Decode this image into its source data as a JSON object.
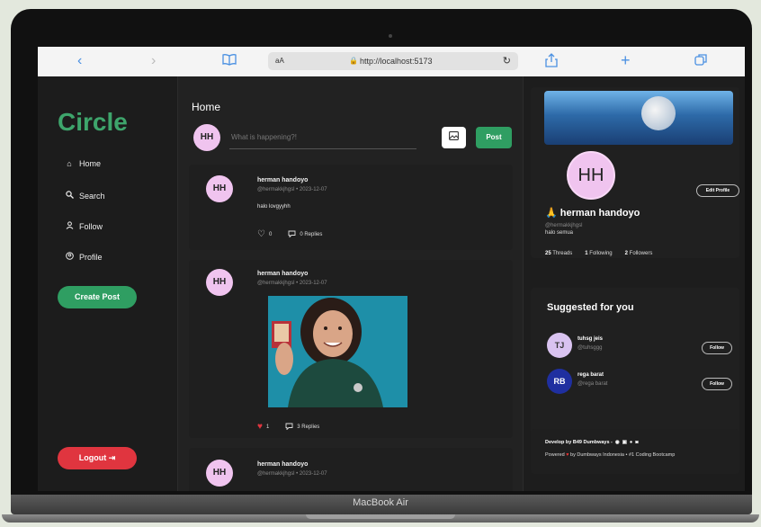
{
  "device": {
    "label": "MacBook Air"
  },
  "browser": {
    "text_size_label": "aA",
    "url": "http://localhost:5173"
  },
  "sidebar": {
    "logo": "Circle",
    "items": [
      {
        "label": "Home",
        "icon": "house-icon"
      },
      {
        "label": "Search",
        "icon": "search-icon"
      },
      {
        "label": "Follow",
        "icon": "person-icon"
      },
      {
        "label": "Profile",
        "icon": "profile-circle-icon"
      }
    ],
    "create_post": "Create Post",
    "logout": "Logout"
  },
  "feed": {
    "title": "Home",
    "composer": {
      "avatar": "HH",
      "placeholder": "What is happening?!",
      "post_button": "Post"
    },
    "posts": [
      {
        "avatar": "HH",
        "name": "herman handoyo",
        "handle": "@hermakkjhgsl",
        "date": "2023-12-07",
        "text": "halo lovgyyhh",
        "likes": "0",
        "replies": "0 Replies",
        "liked": false
      },
      {
        "avatar": "HH",
        "name": "herman handoyo",
        "handle": "@hermakkjhgsl",
        "date": "2023-12-07",
        "text": "",
        "likes": "1",
        "replies": "3 Replies",
        "liked": true
      },
      {
        "avatar": "HH",
        "name": "herman handoyo",
        "handle": "@hermakkjhgsl",
        "date": "2023-12-07",
        "text": ""
      }
    ]
  },
  "profile": {
    "avatar": "HH",
    "edit_button": "Edit Profile",
    "emoji": "🙏",
    "name": "herman handoyo",
    "handle": "@hermakkjhgsl",
    "bio": "halo semua",
    "threads": "25",
    "threads_label": "Threads",
    "following": "1",
    "following_label": "Following",
    "followers": "2",
    "followers_label": "Followers"
  },
  "suggested": {
    "title": "Suggested for you",
    "users": [
      {
        "avatar": "TJ",
        "name": "tuhsg jeis",
        "handle": "@tuhsggg",
        "button": "Follow",
        "color": "#d9c3f0",
        "text_color": "#333333"
      },
      {
        "avatar": "RB",
        "name": "rega barat",
        "handle": "@rega barat",
        "button": "Follow",
        "color": "#1f2fa0",
        "text_color": "#ffffff"
      }
    ]
  },
  "footer": {
    "line1": "Develop by B49 Dumbways -",
    "line2_pre": "Powered",
    "line2_post": "by Dumbways Indonesia • #1 Coding Bootcamp"
  },
  "colors": {
    "accent": "#2f9e62",
    "logout": "#e0353f",
    "avatar": "#f0c4ef"
  }
}
